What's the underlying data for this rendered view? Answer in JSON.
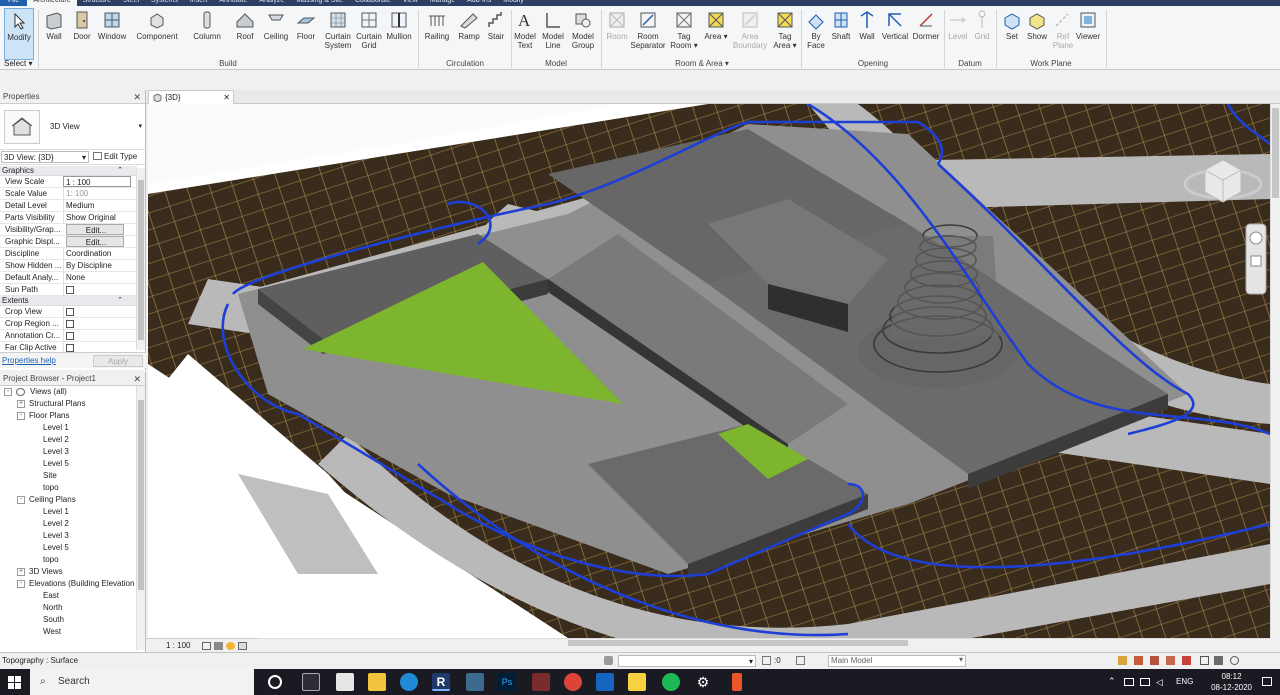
{
  "ribbon_tabs": [
    "File",
    "Architecture",
    "Structure",
    "Steel",
    "Systems",
    "Insert",
    "Annotate",
    "Analyze",
    "Massing & Site",
    "Collaborate",
    "View",
    "Manage",
    "Add-Ins",
    "Modify"
  ],
  "ribbon": {
    "select_label": "Select",
    "buttons": {
      "modify": "Modify",
      "wall": "Wall",
      "door": "Door",
      "window": "Window",
      "component": "Component",
      "column": "Column",
      "roof": "Roof",
      "ceiling": "Ceiling",
      "floor": "Floor",
      "curtain_system": "Curtain System",
      "curtain_grid": "Curtain Grid",
      "mullion": "Mullion",
      "railing": "Railing",
      "ramp": "Ramp",
      "stair": "Stair",
      "model_text": "Model Text",
      "model_line": "Model Line",
      "model_group": "Model Group",
      "room": "Room",
      "room_separator": "Room Separator",
      "tag_room": "Tag Room",
      "area": "Area",
      "area_boundary": "Area Boundary",
      "tag_area": "Tag Area",
      "by_face": "By Face",
      "shaft": "Shaft",
      "wall_opening": "Wall",
      "vertical": "Vertical",
      "dormer": "Dormer",
      "level": "Level",
      "grid": "Grid",
      "set": "Set",
      "show": "Show",
      "ref_plane": "Ref Plane",
      "viewer": "Viewer"
    },
    "groups": {
      "build": "Build",
      "circulation": "Circulation",
      "model": "Model",
      "room_area": "Room & Area",
      "opening": "Opening",
      "datum": "Datum",
      "work_plane": "Work Plane"
    }
  },
  "properties": {
    "title": "Properties",
    "type_name": "3D View",
    "instance": "3D View: {3D}",
    "edit_type": "Edit Type",
    "sections": {
      "graphics": "Graphics",
      "extents": "Extents"
    },
    "graphics_rows": [
      {
        "k": "View Scale",
        "v": "1 : 100"
      },
      {
        "k": "Scale Value",
        "v": "1:  100"
      },
      {
        "k": "Detail Level",
        "v": "Medium"
      },
      {
        "k": "Parts Visibility",
        "v": "Show Original"
      },
      {
        "k": "Visibility/Grap...",
        "v": "Edit..."
      },
      {
        "k": "Graphic Displ...",
        "v": "Edit..."
      },
      {
        "k": "Discipline",
        "v": "Coordination"
      },
      {
        "k": "Show Hidden ...",
        "v": "By Discipline"
      },
      {
        "k": "Default Analy...",
        "v": "None"
      },
      {
        "k": "Sun Path",
        "v": ""
      }
    ],
    "extents_rows": [
      {
        "k": "Crop View",
        "v": ""
      },
      {
        "k": "Crop Region ...",
        "v": ""
      },
      {
        "k": "Annotation Cr...",
        "v": ""
      },
      {
        "k": "Far Clip Active",
        "v": ""
      }
    ],
    "help": "Properties help",
    "apply": "Apply"
  },
  "browser": {
    "title": "Project Browser - Project1",
    "nodes": [
      {
        "label": "Views (all)",
        "depth": 0,
        "toggle": "-"
      },
      {
        "label": "Structural Plans",
        "depth": 1,
        "toggle": "+"
      },
      {
        "label": "Floor Plans",
        "depth": 1,
        "toggle": "-"
      },
      {
        "label": "Level 1",
        "depth": 3,
        "toggle": ""
      },
      {
        "label": "Level 2",
        "depth": 3,
        "toggle": ""
      },
      {
        "label": "Level 3",
        "depth": 3,
        "toggle": ""
      },
      {
        "label": "Level 5",
        "depth": 3,
        "toggle": ""
      },
      {
        "label": "Site",
        "depth": 3,
        "toggle": ""
      },
      {
        "label": "topo",
        "depth": 3,
        "toggle": ""
      },
      {
        "label": "Ceiling Plans",
        "depth": 1,
        "toggle": "-"
      },
      {
        "label": "Level 1",
        "depth": 3,
        "toggle": ""
      },
      {
        "label": "Level 2",
        "depth": 3,
        "toggle": ""
      },
      {
        "label": "Level 3",
        "depth": 3,
        "toggle": ""
      },
      {
        "label": "Level 5",
        "depth": 3,
        "toggle": ""
      },
      {
        "label": "topo",
        "depth": 3,
        "toggle": ""
      },
      {
        "label": "3D Views",
        "depth": 1,
        "toggle": "+"
      },
      {
        "label": "Elevations (Building Elevation",
        "depth": 1,
        "toggle": "-"
      },
      {
        "label": "East",
        "depth": 3,
        "toggle": ""
      },
      {
        "label": "North",
        "depth": 3,
        "toggle": ""
      },
      {
        "label": "South",
        "depth": 3,
        "toggle": ""
      },
      {
        "label": "West",
        "depth": 3,
        "toggle": ""
      }
    ]
  },
  "view": {
    "tab_label": "{3D}",
    "scale": "1 : 100"
  },
  "status": {
    "text": "Topography : Surface",
    "zero": ":0",
    "model": "Main Model"
  },
  "taskbar": {
    "search": "Search",
    "lang": "ENG",
    "time": "08:12",
    "date": "08-12-2020"
  },
  "colors": {
    "ground": "#3a2c1c",
    "road": "#b9b9b9",
    "building": "#6e6e6e",
    "roof": "#5d5d5d",
    "grass": "#7db52e",
    "boundary": "#1e3fd6",
    "accent": "#1f5fb0"
  }
}
